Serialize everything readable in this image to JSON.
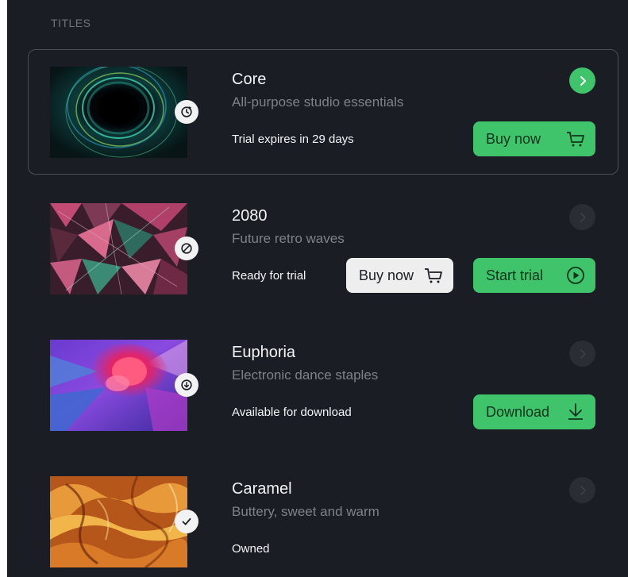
{
  "section_label": "TITLES",
  "cards": [
    {
      "title": "Core",
      "subtitle": "All-purpose studio essentials",
      "status": "Trial expires in 29 days",
      "badge_icon": "clock-refresh-icon",
      "primary_button": {
        "label": "Buy now",
        "icon": "cart-icon"
      }
    },
    {
      "title": "2080",
      "subtitle": "Future retro waves",
      "status": "Ready for trial",
      "badge_icon": "blocked-icon",
      "secondary_button": {
        "label": "Buy now",
        "icon": "cart-icon"
      },
      "primary_button": {
        "label": "Start trial",
        "icon": "play-icon"
      }
    },
    {
      "title": "Euphoria",
      "subtitle": "Electronic dance staples",
      "status": "Available for download",
      "badge_icon": "cloud-download-icon",
      "primary_button": {
        "label": "Download",
        "icon": "download-icon"
      }
    },
    {
      "title": "Caramel",
      "subtitle": "Buttery, sweet and warm",
      "status": "Owned",
      "badge_icon": "checkmark-icon"
    }
  ],
  "colors": {
    "background": "#1a1d23",
    "accent": "#3fc36b",
    "text_primary": "#f3f4f6",
    "text_secondary": "#7d828a"
  }
}
